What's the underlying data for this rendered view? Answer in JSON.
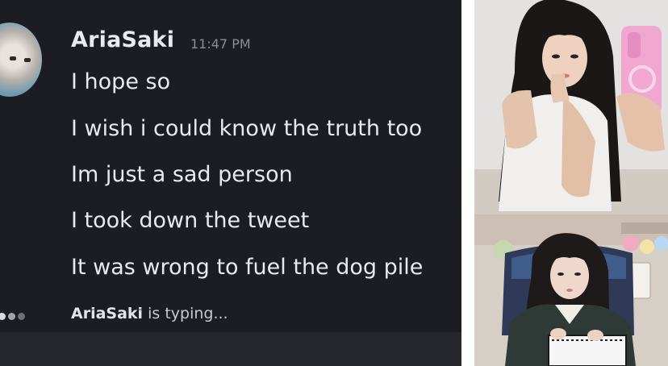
{
  "chat": {
    "username": "AriaSaki",
    "timestamp": "11:47 PM",
    "messages": [
      "I hope so",
      "I wish i could know the truth too",
      "Im just a sad person",
      "I took down the tweet",
      "It was wrong to fuel the dog pile"
    ],
    "typing_user": "AriaSaki",
    "typing_suffix": " is typing..."
  },
  "colors": {
    "chat_background": "#1c1d22",
    "text": "#e8e9ed",
    "timestamp": "#8a8d94"
  },
  "photos": {
    "top": {
      "subject": "mirror selfie with pink phone"
    },
    "bottom": {
      "subject": "streamer webcam in gaming chair"
    }
  }
}
